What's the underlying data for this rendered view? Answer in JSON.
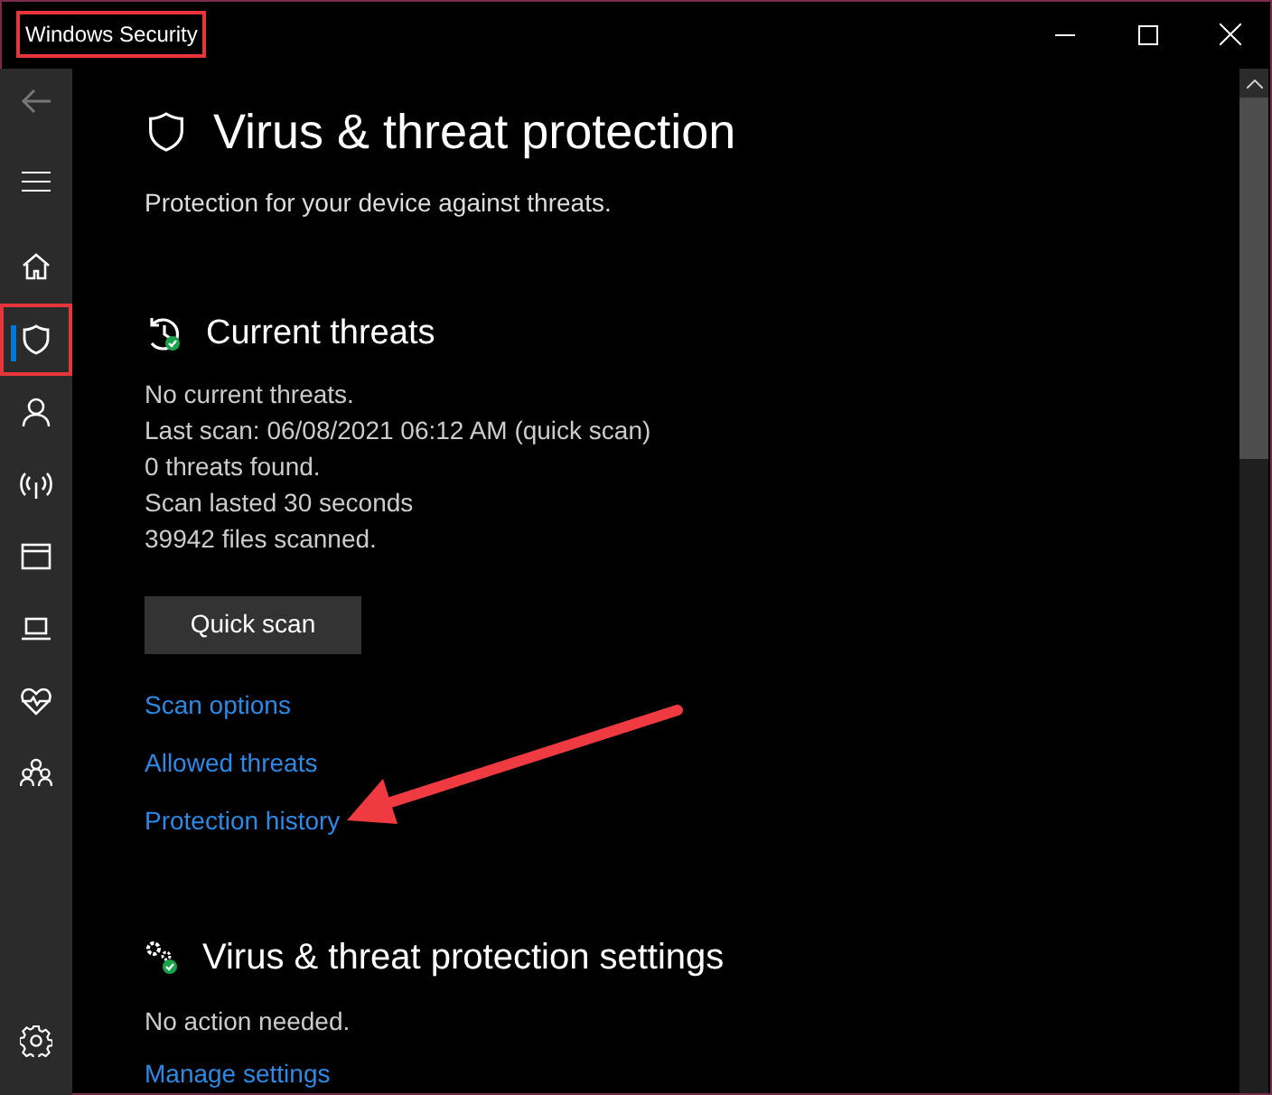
{
  "window": {
    "title": "Windows Security",
    "title_highlighted": true
  },
  "sidebar": {
    "items": [
      {
        "kind": "home",
        "selected": false,
        "highlighted": false
      },
      {
        "kind": "shield",
        "selected": true,
        "highlighted": true
      },
      {
        "kind": "person",
        "selected": false,
        "highlighted": false
      },
      {
        "kind": "wireless",
        "selected": false,
        "highlighted": false
      },
      {
        "kind": "browser",
        "selected": false,
        "highlighted": false
      },
      {
        "kind": "laptop",
        "selected": false,
        "highlighted": false
      },
      {
        "kind": "heart",
        "selected": false,
        "highlighted": false
      },
      {
        "kind": "family",
        "selected": false,
        "highlighted": false
      }
    ]
  },
  "page": {
    "title": "Virus & threat protection",
    "subtitle": "Protection for your device against threats."
  },
  "current_threats": {
    "heading": "Current threats",
    "lines": [
      "No current threats.",
      "Last scan: 06/08/2021 06:12 AM (quick scan)",
      "0 threats found.",
      "Scan lasted 30 seconds",
      "39942 files scanned."
    ],
    "button": "Quick scan",
    "links": [
      {
        "label": "Scan options",
        "pointed_at": false
      },
      {
        "label": "Allowed threats",
        "pointed_at": false
      },
      {
        "label": "Protection history",
        "pointed_at": true
      }
    ]
  },
  "settings": {
    "heading": "Virus & threat protection settings",
    "status": "No action needed.",
    "link": "Manage settings"
  }
}
